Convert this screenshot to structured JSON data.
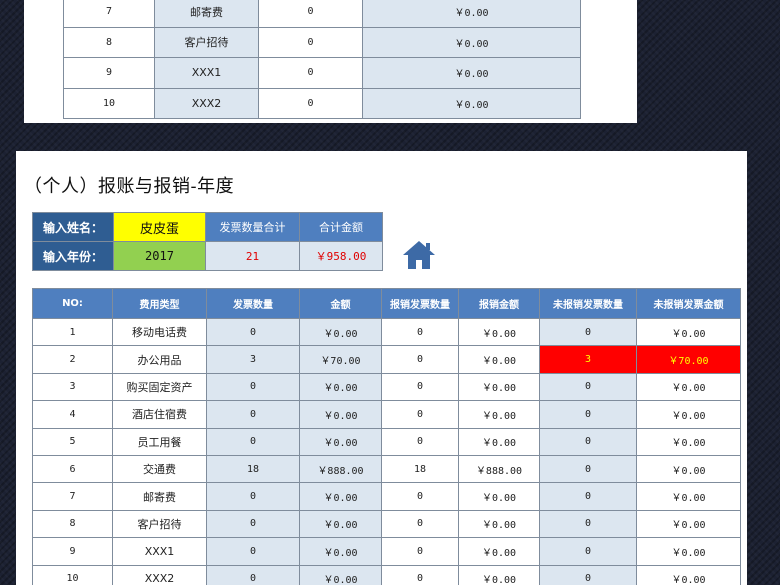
{
  "top_table": {
    "rows": [
      {
        "no": "7",
        "type": "邮寄费",
        "count": "0",
        "amount": "￥0.00"
      },
      {
        "no": "8",
        "type": "客户招待",
        "count": "0",
        "amount": "￥0.00"
      },
      {
        "no": "9",
        "type": "XXX1",
        "count": "0",
        "amount": "￥0.00"
      },
      {
        "no": "10",
        "type": "XXX2",
        "count": "0",
        "amount": "￥0.00"
      }
    ]
  },
  "title": "（个人）报账与报销-年度",
  "summary": {
    "name_label": "输入姓名：",
    "name_value": "皮皮蛋",
    "year_label": "输入年份：",
    "year_value": "2017",
    "invoice_total_label": "发票数量合计",
    "invoice_total_value": "21",
    "amount_total_label": "合计金额",
    "amount_total_value": "￥958.00"
  },
  "icons": {
    "home": "home-icon"
  },
  "colors": {
    "header_blue": "#4f7fbf",
    "label_dark_blue": "#2f5d92",
    "cell_light_blue": "#dce6f0",
    "name_yellow": "#ffff00",
    "year_green": "#92d050",
    "alert_red": "#ff0000",
    "alert_text": "#ffff00"
  },
  "main_table": {
    "headers": [
      "NO:",
      "费用类型",
      "发票数量",
      "金额",
      "报销发票数量",
      "报销金额",
      "未报销发票数量",
      "未报销发票金额"
    ],
    "rows": [
      {
        "no": "1",
        "type": "移动电话费",
        "invoices": "0",
        "amount": "￥0.00",
        "reimb_count": "0",
        "reimb_amount": "￥0.00",
        "unreimb_count": "0",
        "unreimb_amount": "￥0.00",
        "alert": false
      },
      {
        "no": "2",
        "type": "办公用品",
        "invoices": "3",
        "amount": "￥70.00",
        "reimb_count": "0",
        "reimb_amount": "￥0.00",
        "unreimb_count": "3",
        "unreimb_amount": "￥70.00",
        "alert": true
      },
      {
        "no": "3",
        "type": "购买固定资产",
        "invoices": "0",
        "amount": "￥0.00",
        "reimb_count": "0",
        "reimb_amount": "￥0.00",
        "unreimb_count": "0",
        "unreimb_amount": "￥0.00",
        "alert": false
      },
      {
        "no": "4",
        "type": "酒店住宿费",
        "invoices": "0",
        "amount": "￥0.00",
        "reimb_count": "0",
        "reimb_amount": "￥0.00",
        "unreimb_count": "0",
        "unreimb_amount": "￥0.00",
        "alert": false
      },
      {
        "no": "5",
        "type": "员工用餐",
        "invoices": "0",
        "amount": "￥0.00",
        "reimb_count": "0",
        "reimb_amount": "￥0.00",
        "unreimb_count": "0",
        "unreimb_amount": "￥0.00",
        "alert": false
      },
      {
        "no": "6",
        "type": "交通费",
        "invoices": "18",
        "amount": "￥888.00",
        "reimb_count": "18",
        "reimb_amount": "￥888.00",
        "unreimb_count": "0",
        "unreimb_amount": "￥0.00",
        "alert": false
      },
      {
        "no": "7",
        "type": "邮寄费",
        "invoices": "0",
        "amount": "￥0.00",
        "reimb_count": "0",
        "reimb_amount": "￥0.00",
        "unreimb_count": "0",
        "unreimb_amount": "￥0.00",
        "alert": false
      },
      {
        "no": "8",
        "type": "客户招待",
        "invoices": "0",
        "amount": "￥0.00",
        "reimb_count": "0",
        "reimb_amount": "￥0.00",
        "unreimb_count": "0",
        "unreimb_amount": "￥0.00",
        "alert": false
      },
      {
        "no": "9",
        "type": "XXX1",
        "invoices": "0",
        "amount": "￥0.00",
        "reimb_count": "0",
        "reimb_amount": "￥0.00",
        "unreimb_count": "0",
        "unreimb_amount": "￥0.00",
        "alert": false
      },
      {
        "no": "10",
        "type": "XXX2",
        "invoices": "0",
        "amount": "￥0.00",
        "reimb_count": "0",
        "reimb_amount": "￥0.00",
        "unreimb_count": "0",
        "unreimb_amount": "￥0.00",
        "alert": false
      }
    ]
  }
}
